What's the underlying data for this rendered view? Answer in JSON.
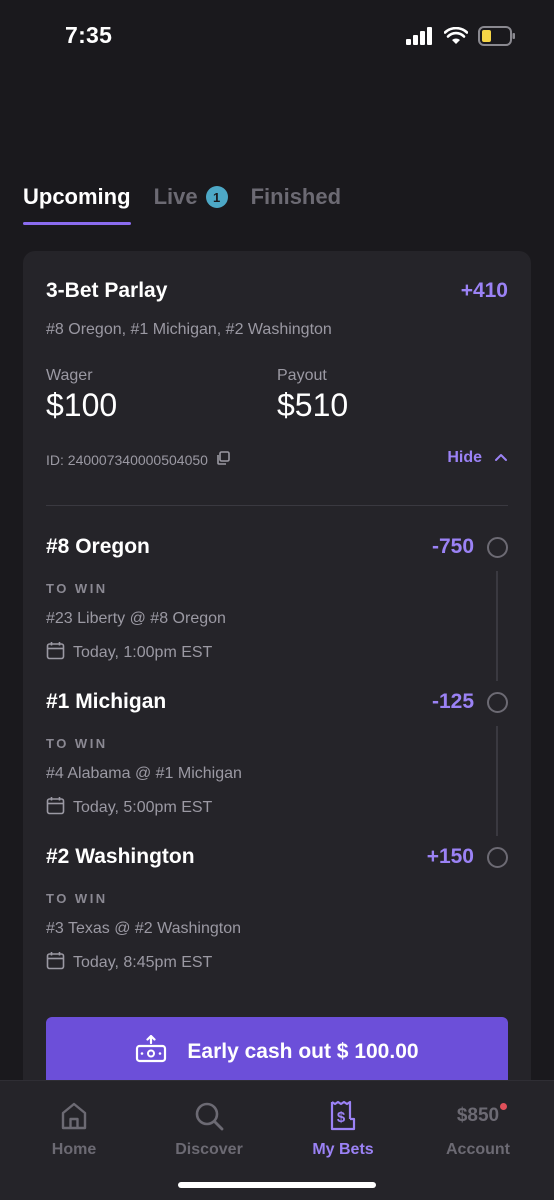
{
  "status_bar": {
    "time": "7:35"
  },
  "tabs": [
    {
      "label": "Upcoming",
      "active": true
    },
    {
      "label": "Live",
      "badge": "1"
    },
    {
      "label": "Finished"
    }
  ],
  "bet": {
    "title": "3-Bet Parlay",
    "odds": "+410",
    "teams": "#8 Oregon, #1 Michigan, #2 Washington",
    "wager_label": "Wager",
    "wager": "$100",
    "payout_label": "Payout",
    "payout": "$510",
    "id": "ID: 240007340000504050",
    "hide_label": "Hide",
    "legs": [
      {
        "name": "#8 Oregon",
        "odds": "-750",
        "type": "TO WIN",
        "match": "#23 Liberty @ #8 Oregon",
        "date": "Today, 1:00pm EST"
      },
      {
        "name": "#1 Michigan",
        "odds": "-125",
        "type": "TO WIN",
        "match": "#4 Alabama @ #1 Michigan",
        "date": "Today, 5:00pm EST"
      },
      {
        "name": "#2 Washington",
        "odds": "+150",
        "type": "TO WIN",
        "match": "#3 Texas @ #2 Washington",
        "date": "Today, 8:45pm EST"
      }
    ],
    "cashout_label": "Early cash out $ 100.00"
  },
  "nav": {
    "home": "Home",
    "discover": "Discover",
    "my_bets": "My Bets",
    "account": "Account",
    "balance": "$850"
  },
  "colors": {
    "accent": "#9b82f5",
    "button": "#6c4fd9",
    "badge": "#4da8c6",
    "background": "#1a191d",
    "card": "#252429"
  }
}
